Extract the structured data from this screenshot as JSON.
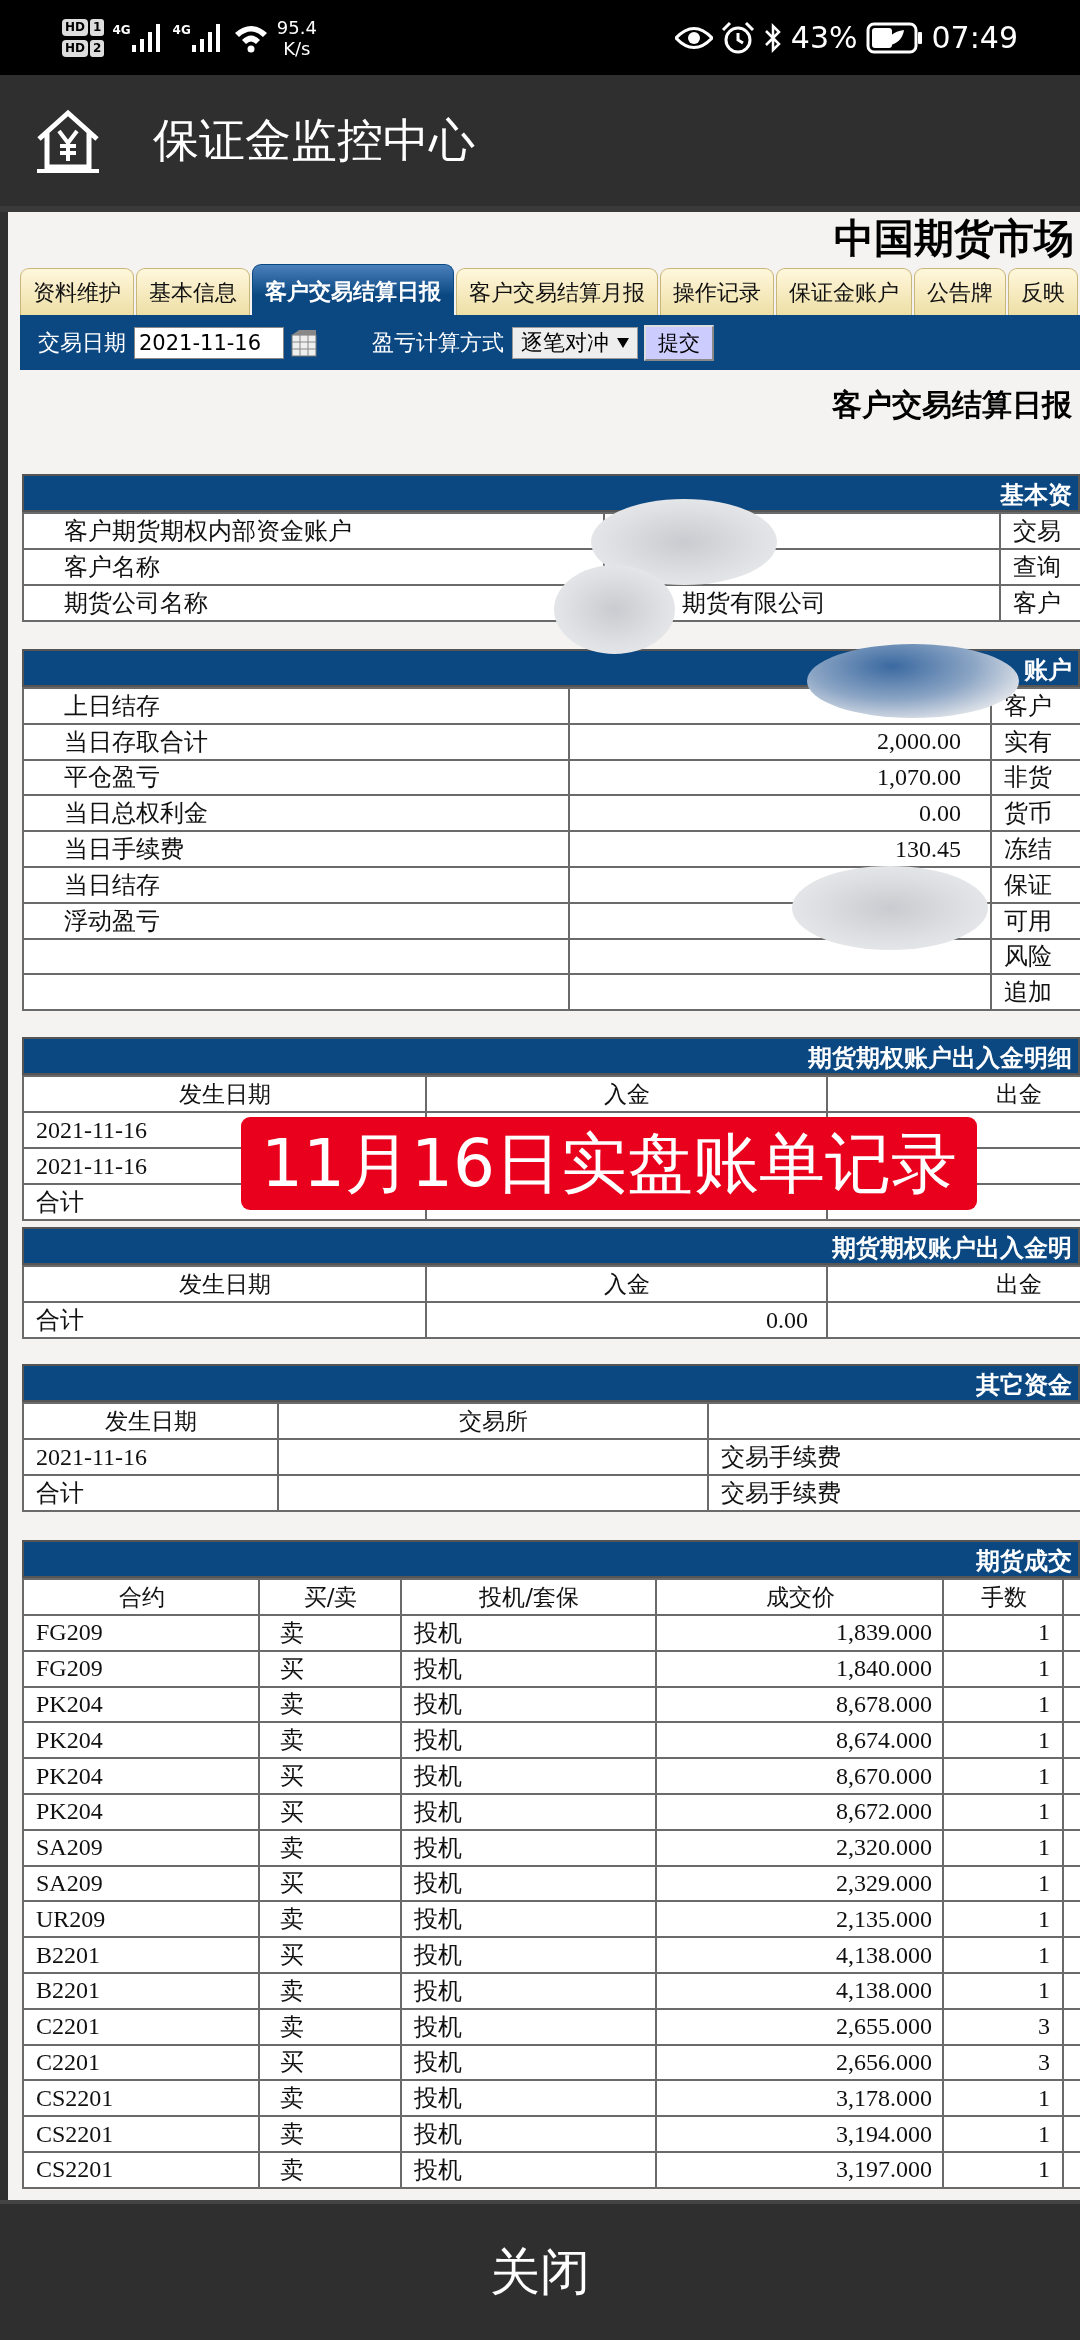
{
  "status_bar": {
    "sims": [
      {
        "label": "HD",
        "slot": "1"
      },
      {
        "label": "HD",
        "slot": "2"
      }
    ],
    "networks": [
      "4G",
      "4G"
    ],
    "speed": "95.4",
    "speed_unit": "K/s",
    "battery": "43%",
    "time": "07:49"
  },
  "app_bar": {
    "title": "保证金监控中心"
  },
  "page": {
    "site_title": "中国期货市场",
    "tabs": [
      {
        "label": "资料维护",
        "selected": false
      },
      {
        "label": "基本信息",
        "selected": false
      },
      {
        "label": "客户交易结算日报",
        "selected": true
      },
      {
        "label": "客户交易结算月报",
        "selected": false
      },
      {
        "label": "操作记录",
        "selected": false
      },
      {
        "label": "保证金账户",
        "selected": false
      },
      {
        "label": "公告牌",
        "selected": false
      },
      {
        "label": "反映",
        "selected": false
      }
    ],
    "filter": {
      "date_label": "交易日期",
      "date_value": "2021-11-16",
      "method_label": "盈亏计算方式",
      "method_value": "逐笔对冲",
      "submit": "提交"
    },
    "report_title": "客户交易结算日报",
    "sections": [
      {
        "title": "基本资",
        "rows": [
          {
            "column_1": "客户期货期权内部资金账户",
            "column_3": "交易"
          },
          {
            "column_1": "客户名称",
            "column_3": "查询"
          },
          {
            "column_1": "期货公司名称",
            "column_2": "期货有限公司",
            "column_3": "客户"
          }
        ]
      },
      {
        "title": "账户",
        "rows": [
          {
            "column_1": "上日结存",
            "column_3": "客户"
          },
          {
            "column_1": "当日存取合计",
            "column_2": "2,000.00",
            "column_3": "实有"
          },
          {
            "column_1": "平仓盈亏",
            "column_2": "1,070.00",
            "column_3": "非货"
          },
          {
            "column_1": "当日总权利金",
            "column_2": "0.00",
            "column_3": "货币"
          },
          {
            "column_1": "当日手续费",
            "column_2": "130.45",
            "column_3": "冻结"
          },
          {
            "column_1": "当日结存",
            "column_3": "保证"
          },
          {
            "column_1": "浮动盈亏",
            "column_3": "可用"
          },
          {
            "column_3": "风险"
          },
          {
            "column_3": "追加"
          }
        ]
      },
      {
        "title": "期货期权账户出入金明细",
        "columns": {
          "column_1": "发生日期",
          "column_2": "入金",
          "column_3": "出金"
        },
        "rows": [
          {
            "column_1": "2021-11-16"
          },
          {
            "column_1": "2021-11-16"
          },
          {
            "column_1": "合计"
          }
        ]
      },
      {
        "title": "期货期权账户出入金明",
        "columns": {
          "column_1": "发生日期",
          "column_2": "入金",
          "column_3": "出金"
        },
        "rows": [
          {
            "column_1": "合计",
            "column_2": "0.00"
          }
        ]
      },
      {
        "title": "其它资金",
        "columns": {
          "column_1": "发生日期",
          "column_2": "交易所"
        },
        "rows": [
          {
            "column_1": "2021-11-16",
            "column_3": "交易手续费"
          },
          {
            "column_1": "合计",
            "column_3": "交易手续费"
          }
        ]
      },
      {
        "title": "期货成交",
        "columns": {
          "column_1": "合约",
          "column_2": "买/卖",
          "column_3": "投机/套保",
          "column_4": "成交价",
          "column_5": "手数"
        },
        "rows": [
          {
            "column_1": "FG209",
            "column_2": "卖",
            "column_3": "投机",
            "column_4": "1,839.000",
            "column_5": "1"
          },
          {
            "column_1": "FG209",
            "column_2": "买",
            "column_3": "投机",
            "column_4": "1,840.000",
            "column_5": "1"
          },
          {
            "column_1": "PK204",
            "column_2": "卖",
            "column_3": "投机",
            "column_4": "8,678.000",
            "column_5": "1"
          },
          {
            "column_1": "PK204",
            "column_2": "卖",
            "column_3": "投机",
            "column_4": "8,674.000",
            "column_5": "1"
          },
          {
            "column_1": "PK204",
            "column_2": "买",
            "column_3": "投机",
            "column_4": "8,670.000",
            "column_5": "1"
          },
          {
            "column_1": "PK204",
            "column_2": "买",
            "column_3": "投机",
            "column_4": "8,672.000",
            "column_5": "1"
          },
          {
            "column_1": "SA209",
            "column_2": "卖",
            "column_3": "投机",
            "column_4": "2,320.000",
            "column_5": "1"
          },
          {
            "column_1": "SA209",
            "column_2": "买",
            "column_3": "投机",
            "column_4": "2,329.000",
            "column_5": "1"
          },
          {
            "column_1": "UR209",
            "column_2": "卖",
            "column_3": "投机",
            "column_4": "2,135.000",
            "column_5": "1"
          },
          {
            "column_1": "B2201",
            "column_2": "买",
            "column_3": "投机",
            "column_4": "4,138.000",
            "column_5": "1"
          },
          {
            "column_1": "B2201",
            "column_2": "卖",
            "column_3": "投机",
            "column_4": "4,138.000",
            "column_5": "1"
          },
          {
            "column_1": "C2201",
            "column_2": "卖",
            "column_3": "投机",
            "column_4": "2,655.000",
            "column_5": "3"
          },
          {
            "column_1": "C2201",
            "column_2": "买",
            "column_3": "投机",
            "column_4": "2,656.000",
            "column_5": "3"
          },
          {
            "column_1": "CS2201",
            "column_2": "卖",
            "column_3": "投机",
            "column_4": "3,178.000",
            "column_5": "1"
          },
          {
            "column_1": "CS2201",
            "column_2": "卖",
            "column_3": "投机",
            "column_4": "3,194.000",
            "column_5": "1"
          },
          {
            "column_1": "CS2201",
            "column_2": "卖",
            "column_3": "投机",
            "column_4": "3,197.000",
            "column_5": "1"
          }
        ]
      }
    ],
    "overlay_caption": "11月16日实盘账单记录"
  },
  "close_button": "关闭"
}
